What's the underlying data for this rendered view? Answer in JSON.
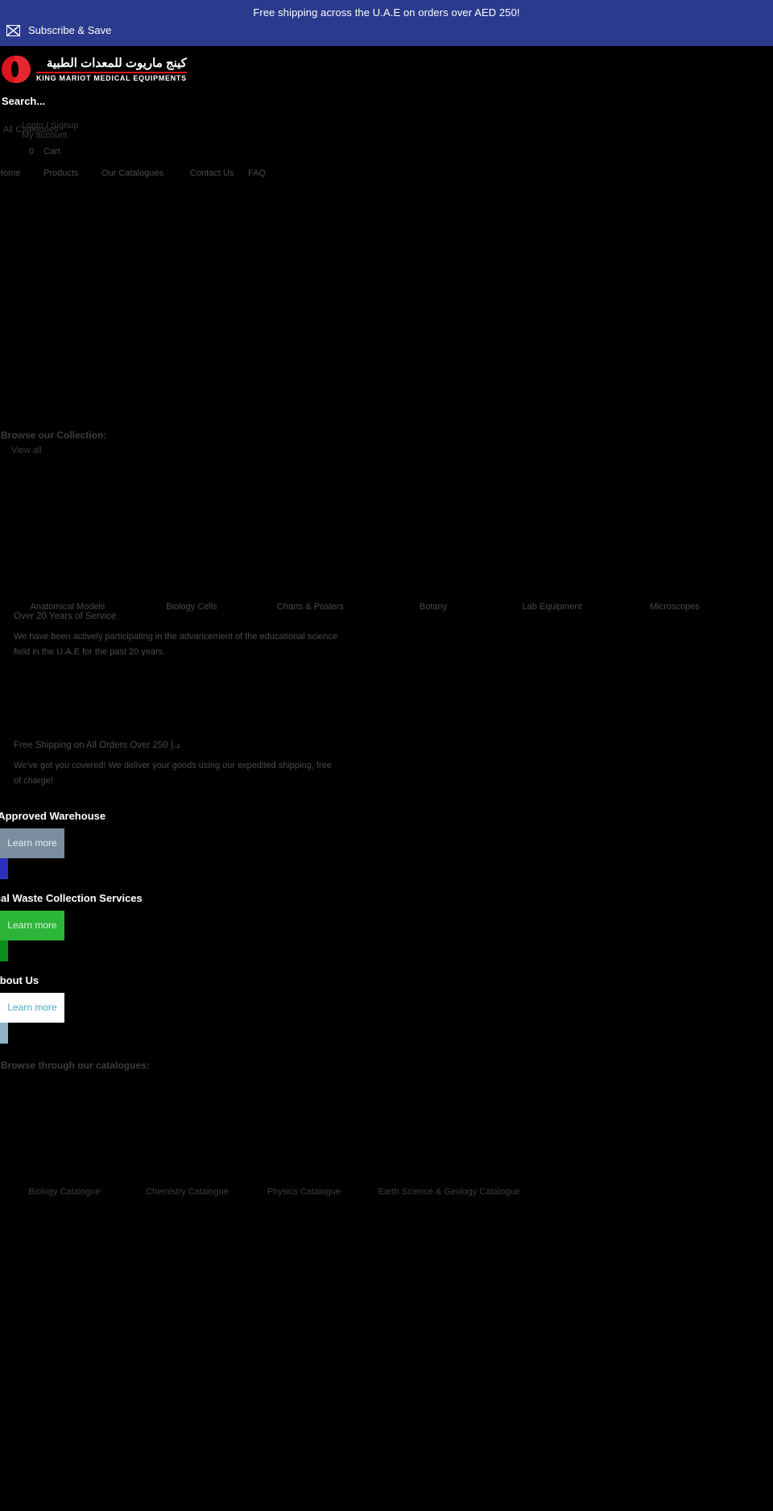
{
  "announcement": {
    "message": "Free shipping across the U.A.E on orders over AED 250!",
    "subscribe_label": "Subscribe & Save",
    "background": "#2a3a8c",
    "envelope_icon": "envelope-icon"
  },
  "header": {
    "logo": {
      "arabic_name": "كينج ماريوت للمعدات الطبية",
      "english_name": "KING MARIOT MEDICAL EQUIPMENTS",
      "mark_color": "#d9151f"
    },
    "search": {
      "placeholder": "Search...",
      "value": "",
      "icon": "search-icon"
    },
    "account": {
      "all_categories": "All Categories",
      "login_signup": "Login / Signup",
      "my_account": "My account"
    },
    "cart": {
      "count": "0",
      "label": "Cart",
      "icon": "cart-icon"
    }
  },
  "nav": {
    "items": [
      {
        "label": "Home"
      },
      {
        "label": "Products"
      },
      {
        "label": "Our Catalogues"
      },
      {
        "label": "Contact Us"
      },
      {
        "label": "FAQ"
      }
    ]
  },
  "collection": {
    "heading": "Browse our Collection:",
    "view_all": "View all",
    "categories": [
      {
        "label": "Anatomical Models"
      },
      {
        "label": "Biology Cells"
      },
      {
        "label": "Charts & Posters"
      },
      {
        "label": "Botany"
      },
      {
        "label": "Lab Equipment"
      },
      {
        "label": "Microscopes"
      }
    ]
  },
  "features": [
    {
      "title": "Over 20 Years of Service",
      "body": "We have been actively participating in the advancement of the educational science field in the U.A.E for the past 20 years."
    },
    {
      "title": "Free Shipping on All Orders Over 250 د.إ",
      "body": "We've got you covered! We deliver your goods using our expedited shipping, free of charge!"
    }
  ],
  "promos": [
    {
      "title": "DOH-Approved Warehouse",
      "button_label": "Learn more",
      "button_color": "#7b8d9e",
      "button_text_color": "#e8eef3",
      "rail_color": "#2a2fbe"
    },
    {
      "title": "Chemical Waste Collection Services",
      "button_label": "Learn more",
      "button_color": "#2bb539",
      "button_text_color": "#ddf5df",
      "rail_color": "#0a8f18"
    },
    {
      "title": "Media: About Us",
      "button_label": "Learn more",
      "button_color": "#ffffff",
      "button_text_color": "#4aa8c4",
      "rail_color": "#8fb4c9"
    }
  ],
  "catalogues": {
    "heading": "Browse through our catalogues:",
    "items": [
      {
        "label": "Biology Catalogue"
      },
      {
        "label": "Chemistry Catalogue"
      },
      {
        "label": "Physics Catalogue"
      },
      {
        "label": "Earth Science & Geology Catalogue"
      }
    ]
  }
}
